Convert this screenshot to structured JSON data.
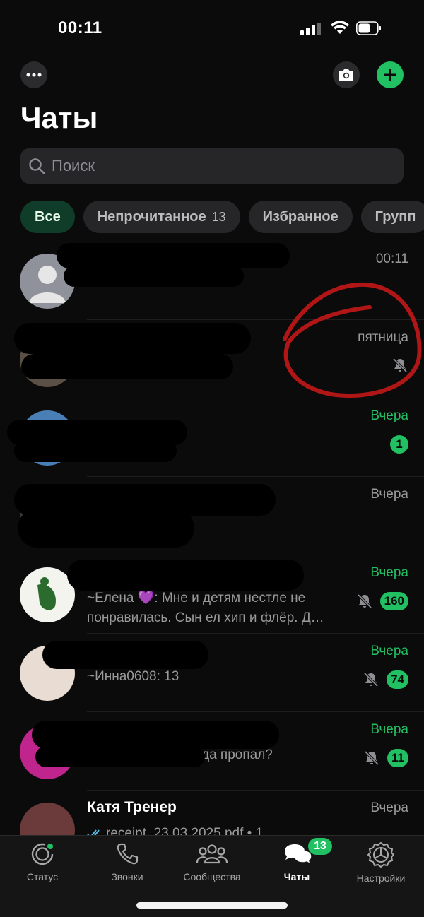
{
  "status_bar": {
    "time": "00:11"
  },
  "header": {
    "title": "Чаты"
  },
  "search": {
    "placeholder": "Поиск"
  },
  "filters": [
    {
      "label": "Все",
      "count": ""
    },
    {
      "label": "Непрочитанное",
      "count": "13"
    },
    {
      "label": "Избранное",
      "count": ""
    },
    {
      "label": "Групп",
      "count": ""
    }
  ],
  "chats": [
    {
      "name": "",
      "preview": "",
      "time": "00:11",
      "unread": "",
      "muted": false
    },
    {
      "name": "",
      "preview": "",
      "time": "пятница",
      "unread": "",
      "muted": true
    },
    {
      "name": "",
      "preview": "",
      "time": "Вчера",
      "unread": "1",
      "muted": false
    },
    {
      "name": "",
      "preview": "",
      "time": "Вчера",
      "unread": "",
      "muted": false
    },
    {
      "name": "",
      "preview": "~Елена 💜: Мне и детям нестле не понравилась. Сын ел хип и флёр. Д…",
      "time": "Вчера",
      "unread": "160",
      "muted": true
    },
    {
      "name": "",
      "preview": "~Инна0608: 13",
      "time": "Вчера",
      "unread": "74",
      "muted": true
    },
    {
      "name": "",
      "preview": "да пропал?",
      "time": "Вчера",
      "unread": "11",
      "muted": true
    },
    {
      "name": "Катя Тренер",
      "preview": "receipt_23.03.2025.pdf • 1",
      "time": "Вчера",
      "unread": "",
      "muted": false
    }
  ],
  "tabbar": {
    "tabs": [
      {
        "label": "Статус"
      },
      {
        "label": "Звонки"
      },
      {
        "label": "Сообщества"
      },
      {
        "label": "Чаты"
      },
      {
        "label": "Настройки"
      }
    ],
    "chats_badge": "13"
  },
  "colors": {
    "accent": "#21c063",
    "background": "#0b0b0b",
    "annotation": "#b01616"
  }
}
